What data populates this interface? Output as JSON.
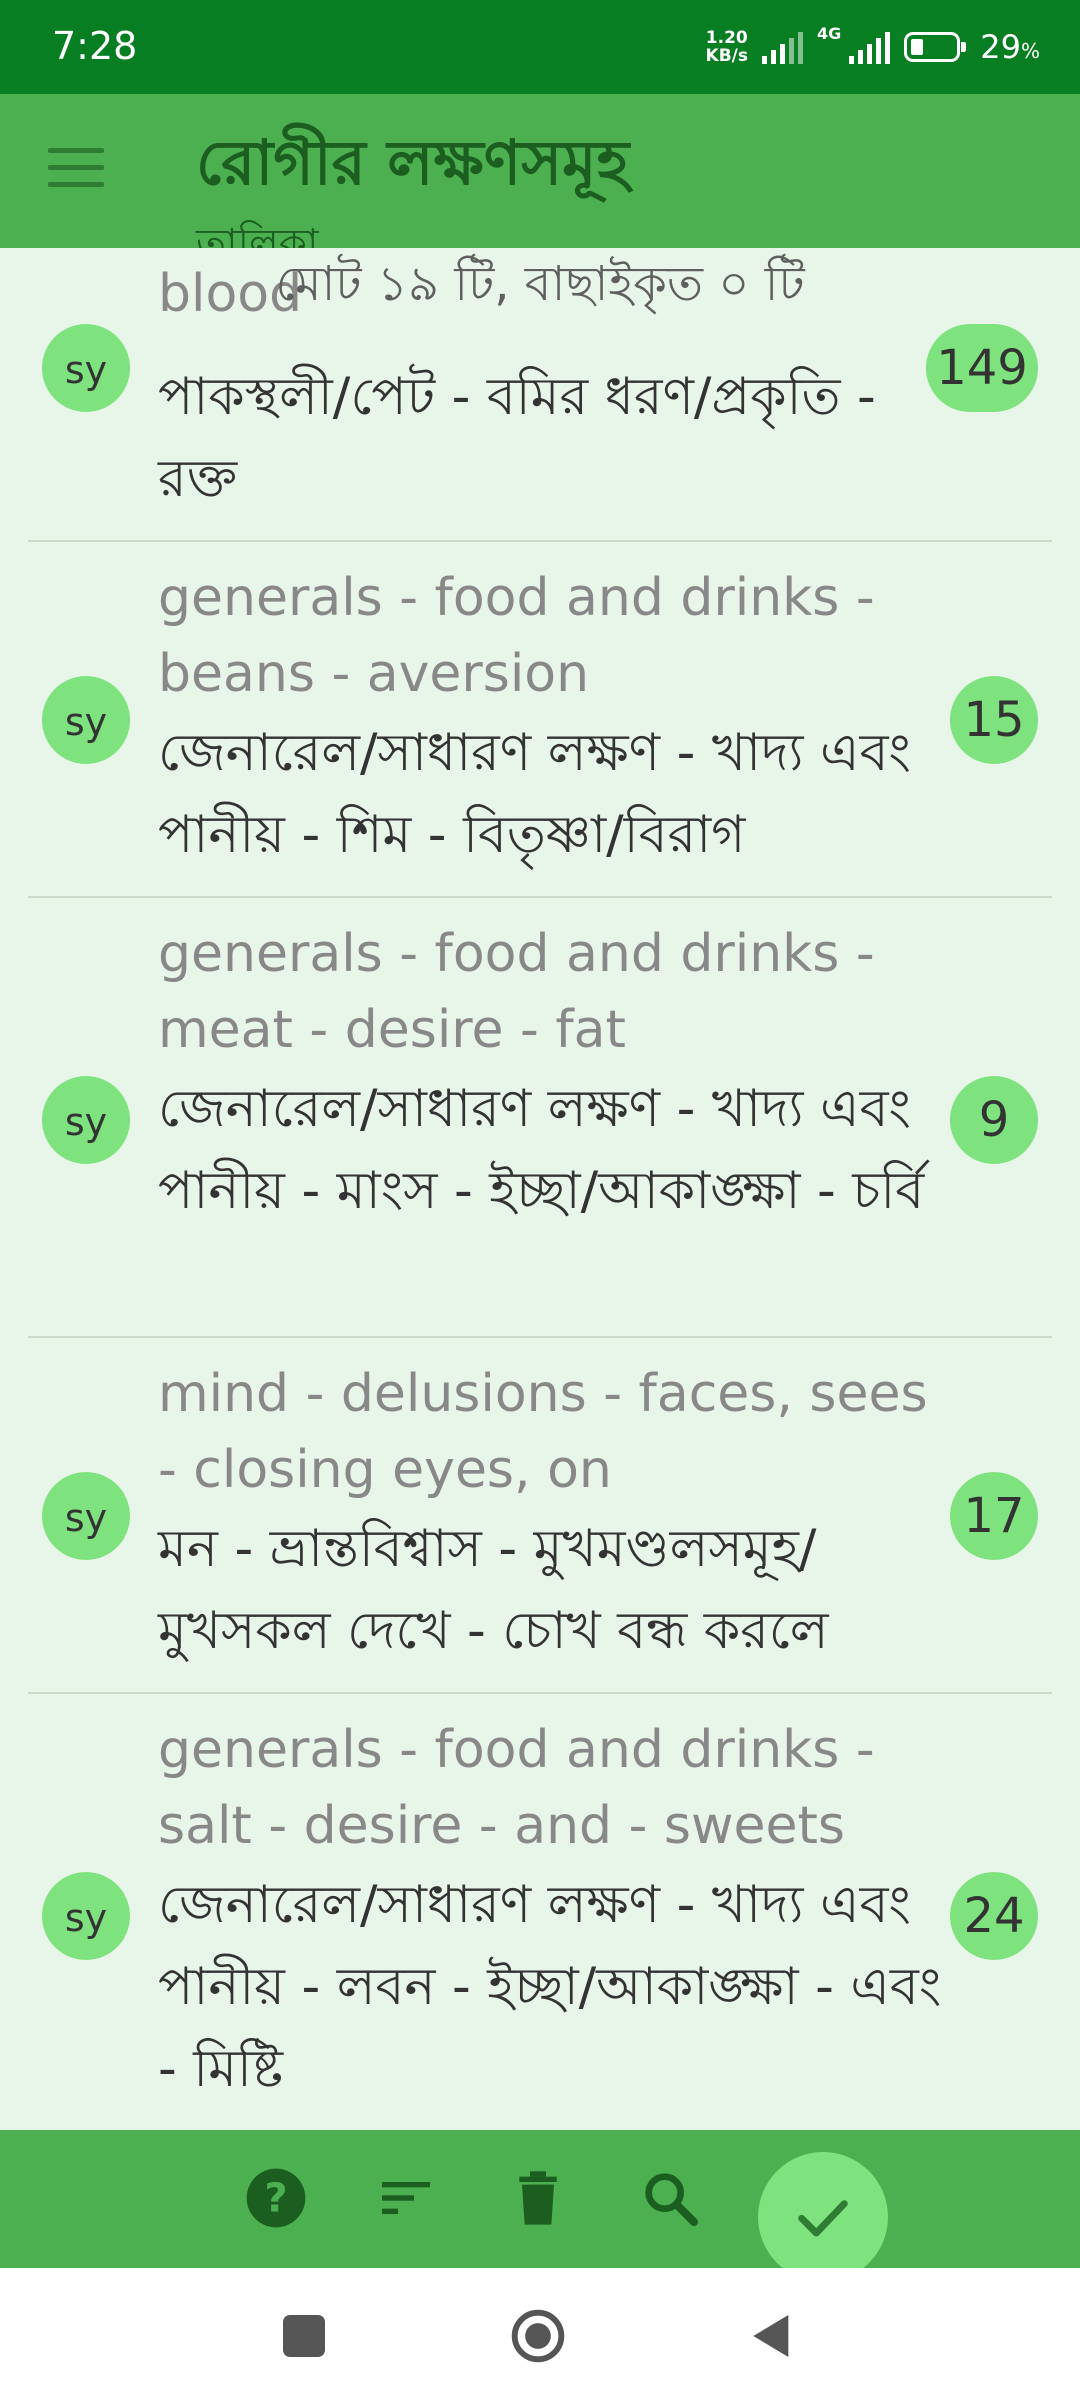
{
  "status": {
    "time": "7:28",
    "net_speed_top": "1.20",
    "net_speed_bottom": "KB/s",
    "network_type": "4G",
    "battery": "29",
    "battery_unit": "%"
  },
  "app_bar": {
    "title": "রোগীর লক্ষণসমূহ",
    "subtitle": "তালিকা"
  },
  "summary": "মোট ১৯ টি, বাছাইকৃত ০ টি",
  "items": [
    {
      "avatar": "sy",
      "english": "blood",
      "bengali": "পাকস্থলী/পেট - বমির ধরণ/প্রকৃতি - রক্ত",
      "count": "149"
    },
    {
      "avatar": "sy",
      "english": "generals - food and drinks - beans - aversion",
      "bengali": "জেনারেল/সাধারণ লক্ষণ - খাদ্য এবং পানীয় - শিম - বিতৃষ্ণা/বিরাগ",
      "count": "15"
    },
    {
      "avatar": "sy",
      "english": "generals - food and drinks - meat - desire - fat",
      "bengali": "জেনারেল/সাধারণ লক্ষণ - খাদ্য এবং পানীয় - মাংস - ইচ্ছা/আকাঙ্ক্ষা - চর্বি",
      "count": "9"
    },
    {
      "avatar": "sy",
      "english": "mind - delusions - faces, sees - closing eyes, on",
      "bengali": "মন - ভ্রান্তবিশ্বাস - মুখমণ্ডলসমূহ/মুখসকল দেখে - চোখ বন্ধ করলে",
      "count": "17"
    },
    {
      "avatar": "sy",
      "english": "generals - food and drinks - salt - desire - and - sweets",
      "bengali": "জেনারেল/সাধারণ লক্ষণ - খাদ্য এবং পানীয় - লবন - ইচ্ছা/আকাঙ্ক্ষা - এবং - মিষ্টি",
      "count": "24"
    }
  ],
  "icons": {
    "help": "help-icon",
    "sort": "sort-icon",
    "delete": "delete-icon",
    "search": "search-icon",
    "confirm": "check-icon"
  },
  "colors": {
    "status_bar": "#087e23",
    "app_bar": "#4caf50",
    "background": "#e8f5e9",
    "badge": "#7ee37e",
    "icon_dark": "#1b5e20"
  }
}
